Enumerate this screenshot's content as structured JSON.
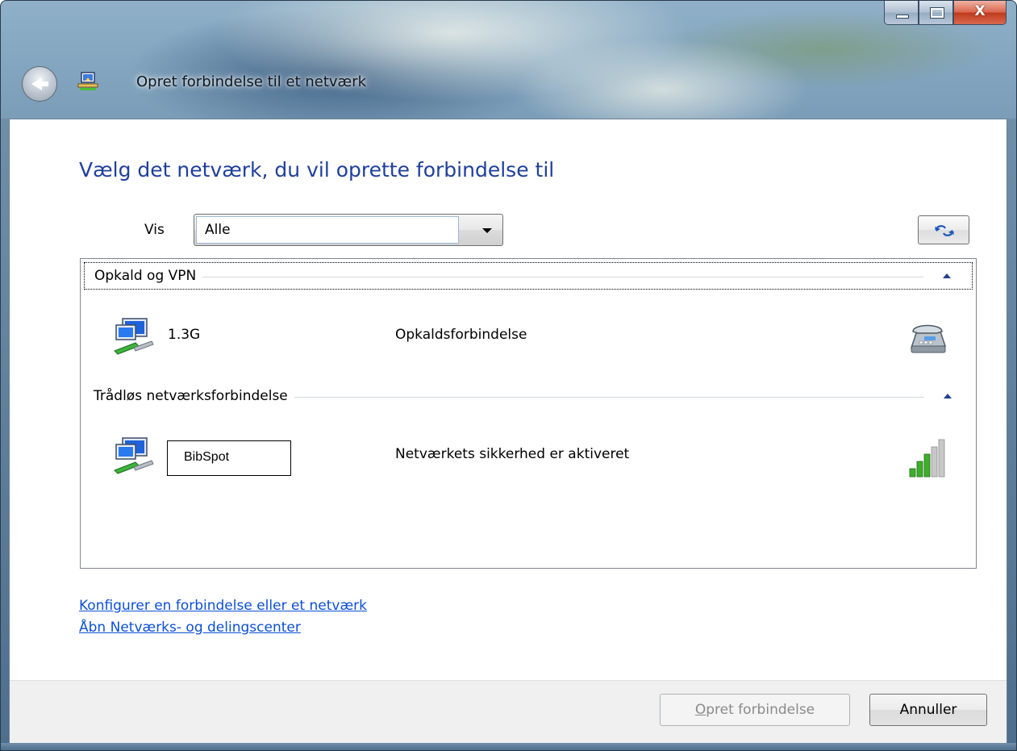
{
  "window": {
    "title": "Opret forbindelse til et netværk",
    "close_glyph": "X"
  },
  "heading": "Vælg det netværk, du vil oprette forbindelse til",
  "filter": {
    "label": "Vis",
    "selected": "Alle"
  },
  "groups": [
    {
      "label": "Opkald og VPN",
      "networks": [
        {
          "name": "1.3G",
          "status": "Opkaldsforbindelse",
          "right_icon": "phone-icon"
        }
      ]
    },
    {
      "label": "Trådløs netværksforbindelse",
      "networks": [
        {
          "name": "BibSpot",
          "status": "Netværkets sikkerhed er aktiveret",
          "right_icon": "signal-strength-icon",
          "signal_bars": 3,
          "signal_max": 5
        }
      ]
    }
  ],
  "links": [
    "Konfigurer en forbindelse eller et netværk",
    "Åbn Netværks- og delingscenter"
  ],
  "buttons": {
    "connect": {
      "accel": "O",
      "rest": "pret forbindelse",
      "enabled": false
    },
    "cancel": "Annuller"
  },
  "colors": {
    "heading": "#1f3f9c",
    "link": "#0b4fd6",
    "signal_on": "#3fae2a",
    "signal_off": "#c8c8c8"
  }
}
